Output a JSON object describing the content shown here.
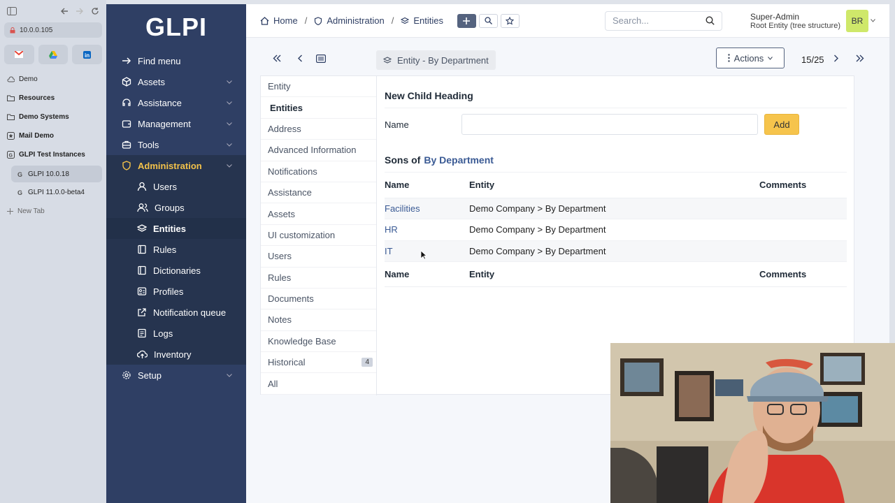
{
  "browser": {
    "url": "10.0.0.105",
    "folders": [
      {
        "label": "Demo"
      },
      {
        "label": "Resources"
      },
      {
        "label": "Demo Systems"
      },
      {
        "label": "Mail Demo"
      },
      {
        "label": "GLPI Test Instances"
      }
    ],
    "tabs": [
      {
        "label": "GLPI 10.0.18"
      },
      {
        "label": "GLPI 11.0.0-beta4"
      }
    ],
    "new_tab": "New Tab"
  },
  "sidebar": {
    "logo": "GLPI",
    "find_menu": "Find menu",
    "sections": [
      {
        "label": "Assets"
      },
      {
        "label": "Assistance"
      },
      {
        "label": "Management"
      },
      {
        "label": "Tools"
      },
      {
        "label": "Administration"
      },
      {
        "label": "Setup"
      }
    ],
    "admin_items": [
      {
        "label": "Users"
      },
      {
        "label": "Groups"
      },
      {
        "label": "Entities"
      },
      {
        "label": "Rules"
      },
      {
        "label": "Dictionaries"
      },
      {
        "label": "Profiles"
      },
      {
        "label": "Notification queue"
      },
      {
        "label": "Logs"
      },
      {
        "label": "Inventory"
      }
    ]
  },
  "header": {
    "breadcrumb": [
      "Home",
      "Administration",
      "Entities"
    ],
    "search_placeholder": "Search...",
    "user_name": "Super-Admin",
    "user_entity": "Root Entity (tree structure)",
    "avatar_initials": "BR"
  },
  "toolbar": {
    "entity_title": "Entity - By Department",
    "actions_label": "Actions",
    "pager": "15/25"
  },
  "tabs": [
    {
      "label": "Entity"
    },
    {
      "label": "Entities"
    },
    {
      "label": "Address"
    },
    {
      "label": "Advanced Information"
    },
    {
      "label": "Notifications"
    },
    {
      "label": "Assistance"
    },
    {
      "label": "Assets"
    },
    {
      "label": "UI customization"
    },
    {
      "label": "Users"
    },
    {
      "label": "Rules"
    },
    {
      "label": "Documents"
    },
    {
      "label": "Notes"
    },
    {
      "label": "Knowledge Base"
    },
    {
      "label": "Historical",
      "badge": "4"
    },
    {
      "label": "All"
    }
  ],
  "content": {
    "new_child_heading": "New Child Heading",
    "name_label": "Name",
    "add_label": "Add",
    "sons_prefix": "Sons of",
    "sons_link": "By Department",
    "columns": [
      "Name",
      "Entity",
      "Comments"
    ],
    "rows": [
      {
        "name": "Facilities",
        "entity": "Demo Company > By Department",
        "comments": ""
      },
      {
        "name": "HR",
        "entity": "Demo Company > By Department",
        "comments": ""
      },
      {
        "name": "IT",
        "entity": "Demo Company > By Department",
        "comments": ""
      }
    ]
  },
  "colors": {
    "sidebar_bg": "#2f3f64",
    "accent": "#f3c24a",
    "add_button": "#f6c44c",
    "link": "#3a5a94"
  }
}
